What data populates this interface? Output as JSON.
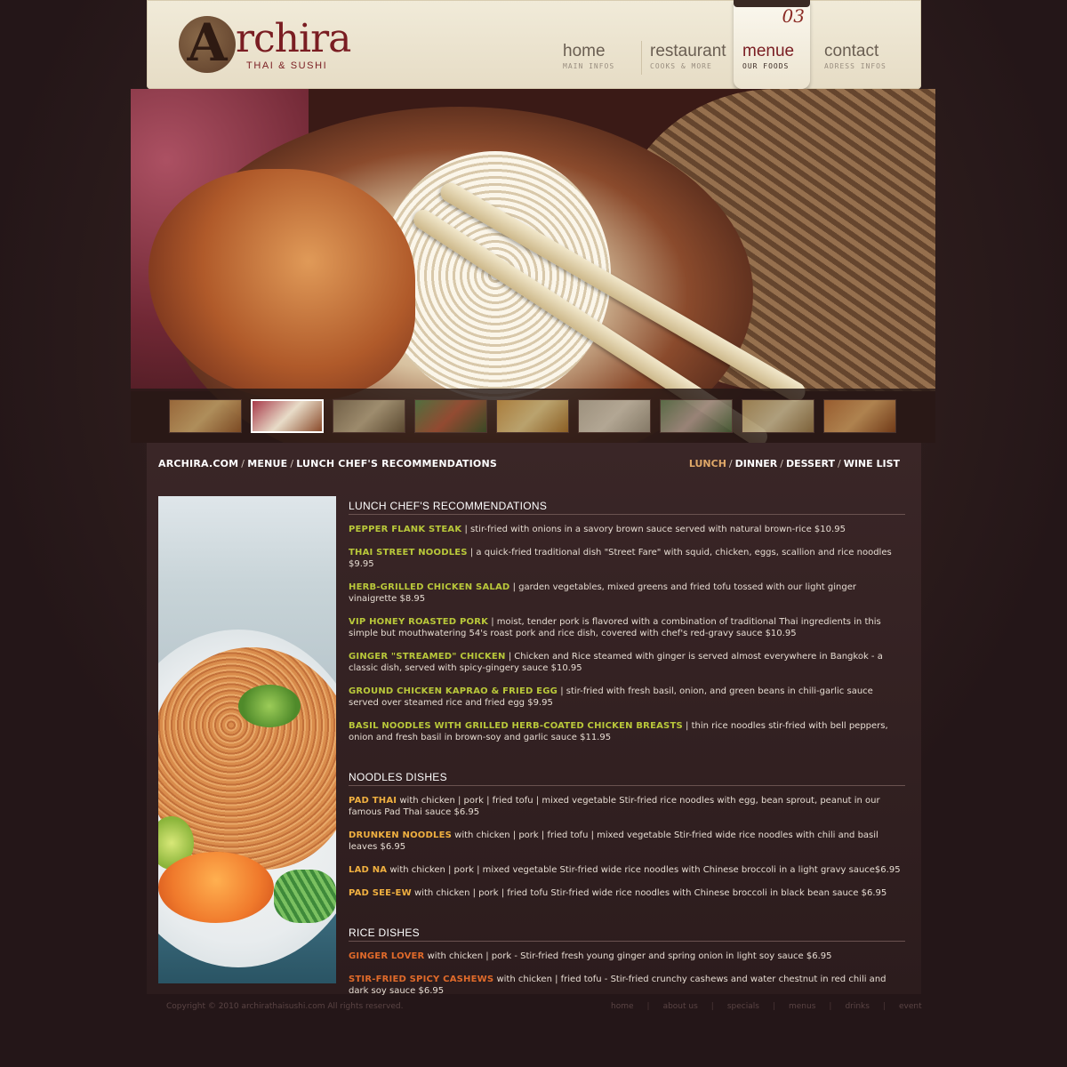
{
  "brand": {
    "name": "Archira",
    "logo_letter": "A",
    "word_rest": "rchira",
    "subtitle": "THAI & SUSHI"
  },
  "nav": [
    {
      "label": "home",
      "sub": "MAIN INFOS",
      "active": false
    },
    {
      "label": "restaurant",
      "sub": "COOKS & MORE",
      "active": false
    },
    {
      "label": "menue",
      "sub": "OUR FOODS",
      "active": true,
      "number": "03"
    },
    {
      "label": "contact",
      "sub": "ADRESS INFOS",
      "active": false
    }
  ],
  "hero": {
    "thumbnail_count": 9,
    "active_thumbnail": 2
  },
  "breadcrumb": [
    "ARCHIRA.COM",
    "MENUE",
    "LUNCH CHEF'S RECOMMENDATIONS"
  ],
  "menu_switch": [
    "LUNCH",
    "DINNER",
    "DESSERT",
    "WINE LIST"
  ],
  "sections": {
    "lunch": {
      "title": "LUNCH CHEF'S RECOMMENDATIONS",
      "items": [
        {
          "name": "PEPPER FLANK STEAK",
          "desc": " | stir-fried with onions in a savory brown sauce served with natural brown-rice $10.95"
        },
        {
          "name": "THAI STREET NOODLES",
          "desc": " | a quick-fried traditional dish \"Street Fare\" with squid, chicken, eggs, scallion and rice noodles $9.95"
        },
        {
          "name": "HERB-GRILLED CHICKEN SALAD",
          "desc": " | garden vegetables, mixed greens and fried tofu tossed with our light ginger vinaigrette $8.95"
        },
        {
          "name": "VIP HONEY ROASTED PORK",
          "desc": " | moist, tender pork is flavored with a combination of traditional Thai ingredients in this simple but mouthwatering 54's roast pork and rice dish, covered with chef's red-gravy sauce $10.95"
        },
        {
          "name": "GINGER \"STREAMED\" CHICKEN",
          "desc": " | Chicken and Rice steamed with ginger is served almost everywhere in Bangkok - a classic dish, served with spicy-gingery sauce $10.95"
        },
        {
          "name": "GROUND CHICKEN KAPRAO & FRIED EGG",
          "desc": " | stir-fried with fresh basil, onion, and green beans in chili-garlic sauce served over steamed rice and fried egg $9.95"
        },
        {
          "name": "BASIL NOODLES WITH GRILLED HERB-COATED CHICKEN BREASTS",
          "desc": " | thin rice noodles stir-fried with bell peppers, onion and fresh basil in brown-soy and garlic sauce $11.95"
        }
      ]
    },
    "noodles": {
      "title": "NOODLES DISHES",
      "items": [
        {
          "name": "PAD THAI",
          "desc": " with chicken | pork | fried tofu | mixed vegetable Stir-fried rice noodles with egg, bean sprout, peanut in our famous Pad Thai sauce $6.95"
        },
        {
          "name": "DRUNKEN NOODLES",
          "desc": " with chicken | pork | fried tofu | mixed vegetable Stir-fried wide rice noodles with chili and basil leaves $6.95"
        },
        {
          "name": "LAD NA",
          "desc": " with chicken | pork | mixed vegetable Stir-fried wide rice noodles with Chinese broccoli in a light gravy sauce$6.95"
        },
        {
          "name": "PAD SEE-EW",
          "desc": " with chicken | pork | fried tofu Stir-fried wide rice noodles with Chinese broccoli in black bean sauce $6.95"
        }
      ]
    },
    "rice": {
      "title": "RICE DISHES",
      "items": [
        {
          "name": "GINGER LOVER",
          "desc": " with chicken | pork - Stir-fried fresh young ginger and spring onion in light soy sauce $6.95"
        },
        {
          "name": "STIR-FRIED SPICY CASHEWS",
          "desc": " with chicken | fried tofu - Stir-fried crunchy cashews and water chestnut in red chili and dark soy sauce $6.95"
        }
      ]
    }
  },
  "footer": {
    "copyright": "Copyright © 2010 archirathaisushi.com All rights reserved.",
    "links": [
      "home",
      "about us",
      "specials",
      "menus",
      "drinks",
      "event"
    ]
  },
  "colors": {
    "lunch_item": "#b9c83a",
    "noodles_item": "#f0b040",
    "rice_item": "#e06a2a",
    "active_link": "#e0a868",
    "brand_red": "#7a1d22"
  }
}
